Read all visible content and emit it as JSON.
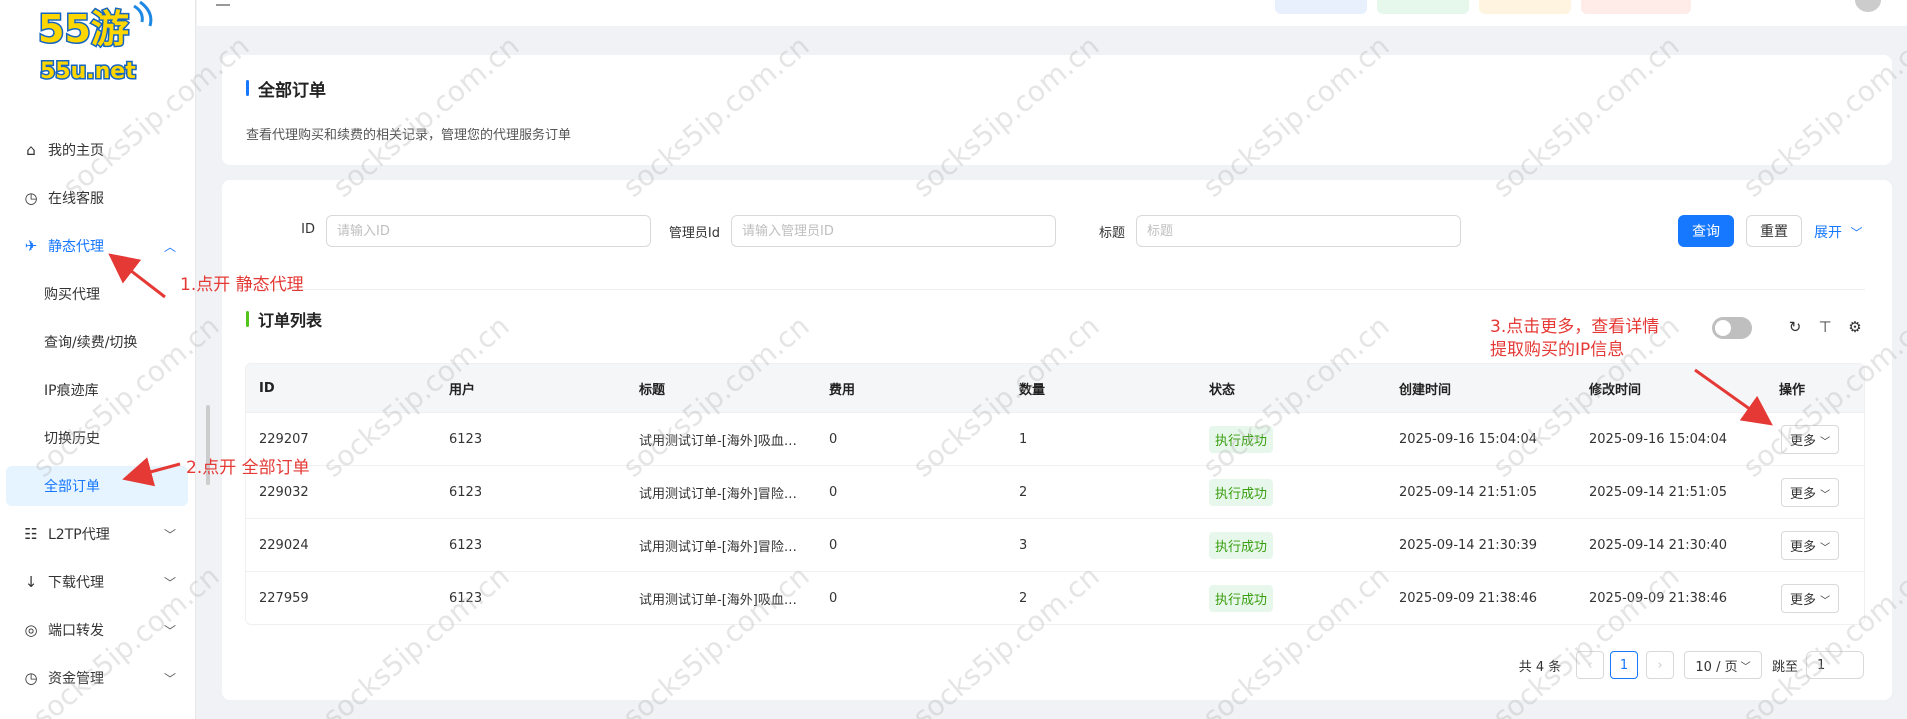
{
  "logo": {
    "main": "55游",
    "sub": "55u.net"
  },
  "sidebar": {
    "items": [
      {
        "label": "我的主页",
        "icon": "home-icon"
      },
      {
        "label": "在线客服",
        "icon": "clock-icon"
      },
      {
        "label": "静态代理",
        "icon": "rocket-icon",
        "expanded": true
      },
      {
        "label": "购买代理"
      },
      {
        "label": "查询/续费/切换"
      },
      {
        "label": "IP痕迹库"
      },
      {
        "label": "切换历史"
      },
      {
        "label": "全部订单",
        "active": true
      },
      {
        "label": "L2TP代理",
        "icon": "network-icon"
      },
      {
        "label": "下载代理",
        "icon": "download-icon"
      },
      {
        "label": "端口转发",
        "icon": "chrome-icon"
      },
      {
        "label": "资金管理",
        "icon": "clock-icon"
      }
    ]
  },
  "header": {
    "title": "全部订单",
    "description": "查看代理购买和续费的相关记录，管理您的代理服务订单"
  },
  "filters": {
    "id_label": "ID",
    "id_placeholder": "请输入ID",
    "admin_label": "管理员Id",
    "admin_placeholder": "请输入管理员ID",
    "title_label": "标题",
    "title_placeholder": "标题",
    "query_button": "查询",
    "reset_button": "重置",
    "expand_link": "展开"
  },
  "table": {
    "title": "订单列表",
    "columns": [
      "ID",
      "用户",
      "标题",
      "费用",
      "数量",
      "状态",
      "创建时间",
      "修改时间",
      "操作"
    ],
    "rows": [
      {
        "id": "229207",
        "user": "6123",
        "title": "试用测试订单-[海外]吸血…",
        "fee": "0",
        "qty": "1",
        "status": "执行成功",
        "created": "2025-09-16 15:04:04",
        "modified": "2025-09-16 15:04:04",
        "action": "更多"
      },
      {
        "id": "229032",
        "user": "6123",
        "title": "试用测试订单-[海外]冒险…",
        "fee": "0",
        "qty": "2",
        "status": "执行成功",
        "created": "2025-09-14 21:51:05",
        "modified": "2025-09-14 21:51:05",
        "action": "更多"
      },
      {
        "id": "229024",
        "user": "6123",
        "title": "试用测试订单-[海外]冒险…",
        "fee": "0",
        "qty": "3",
        "status": "执行成功",
        "created": "2025-09-14 21:30:39",
        "modified": "2025-09-14 21:30:40",
        "action": "更多"
      },
      {
        "id": "227959",
        "user": "6123",
        "title": "试用测试订单-[海外]吸血…",
        "fee": "0",
        "qty": "2",
        "status": "执行成功",
        "created": "2025-09-09 21:38:46",
        "modified": "2025-09-09 21:38:46",
        "action": "更多"
      }
    ]
  },
  "pagination": {
    "total": "共 4 条",
    "current_page": "1",
    "page_size": "10 / 页",
    "jump_label": "跳至",
    "jump_value": "1"
  },
  "annotations": {
    "step1": "1.点开 静态代理",
    "step2": "2.点开 全部订单",
    "step3_line1": "3.点击更多，查看详情",
    "step3_line2": "提取购买的IP信息",
    "color": "#e53935"
  },
  "watermark": "socks5ip.com.cn",
  "colors": {
    "primary": "#1677ff",
    "success_bg": "#e8f7ec",
    "success_text": "#389e0d"
  }
}
